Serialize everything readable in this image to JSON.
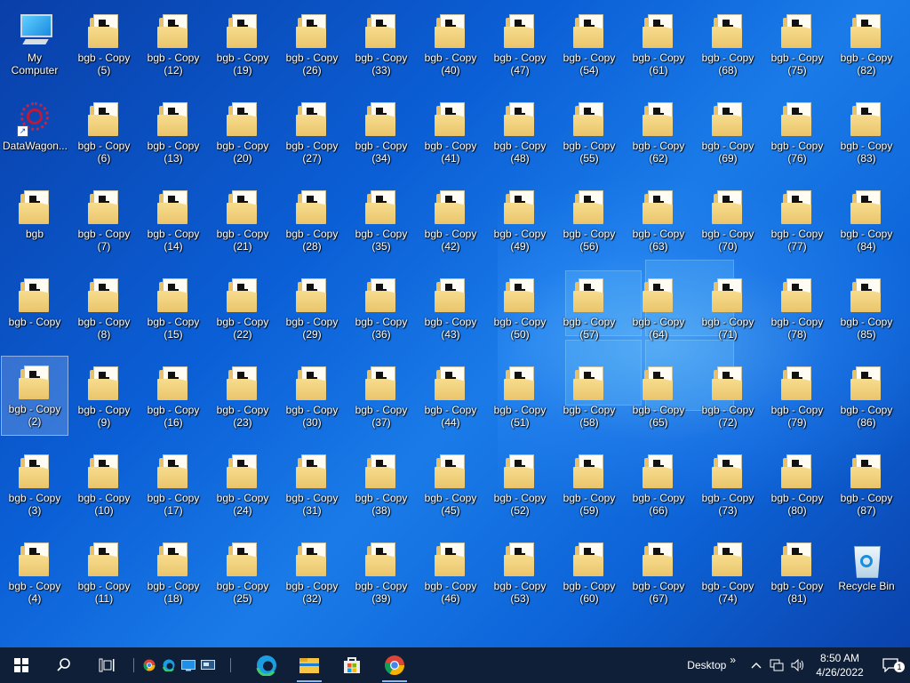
{
  "desktop": {
    "icons": [
      {
        "name": "pc-icon",
        "label": "My Computer",
        "col": 0,
        "row": 0,
        "type": "pc"
      },
      {
        "name": "datawagon-icon",
        "label": "DataWagon...",
        "col": 0,
        "row": 1,
        "type": "dw"
      },
      {
        "name": "folder-icon",
        "label": "bgb",
        "col": 0,
        "row": 2,
        "type": "folder"
      },
      {
        "name": "folder-icon",
        "label": "bgb - Copy",
        "col": 0,
        "row": 3,
        "type": "folder"
      },
      {
        "name": "folder-icon",
        "label": "bgb - Copy\n(2)",
        "col": 0,
        "row": 4,
        "type": "folder",
        "selected": true
      },
      {
        "name": "folder-icon",
        "label": "bgb - Copy\n(3)",
        "col": 0,
        "row": 5,
        "type": "folder"
      },
      {
        "name": "folder-icon",
        "label": "bgb - Copy\n(4)",
        "col": 0,
        "row": 6,
        "type": "folder"
      },
      {
        "name": "folder-icon",
        "label": "bgb - Copy\n(5)",
        "col": 1,
        "row": 0,
        "type": "folder"
      },
      {
        "name": "folder-icon",
        "label": "bgb - Copy\n(6)",
        "col": 1,
        "row": 1,
        "type": "folder"
      },
      {
        "name": "folder-icon",
        "label": "bgb - Copy\n(7)",
        "col": 1,
        "row": 2,
        "type": "folder"
      },
      {
        "name": "folder-icon",
        "label": "bgb - Copy\n(8)",
        "col": 1,
        "row": 3,
        "type": "folder"
      },
      {
        "name": "folder-icon",
        "label": "bgb - Copy\n(9)",
        "col": 1,
        "row": 4,
        "type": "folder"
      },
      {
        "name": "folder-icon",
        "label": "bgb - Copy\n(10)",
        "col": 1,
        "row": 5,
        "type": "folder"
      },
      {
        "name": "folder-icon",
        "label": "bgb - Copy\n(11)",
        "col": 1,
        "row": 6,
        "type": "folder"
      },
      {
        "name": "folder-icon",
        "label": "bgb - Copy\n(12)",
        "col": 2,
        "row": 0,
        "type": "folder"
      },
      {
        "name": "folder-icon",
        "label": "bgb - Copy\n(13)",
        "col": 2,
        "row": 1,
        "type": "folder"
      },
      {
        "name": "folder-icon",
        "label": "bgb - Copy\n(14)",
        "col": 2,
        "row": 2,
        "type": "folder"
      },
      {
        "name": "folder-icon",
        "label": "bgb - Copy\n(15)",
        "col": 2,
        "row": 3,
        "type": "folder"
      },
      {
        "name": "folder-icon",
        "label": "bgb - Copy\n(16)",
        "col": 2,
        "row": 4,
        "type": "folder"
      },
      {
        "name": "folder-icon",
        "label": "bgb - Copy\n(17)",
        "col": 2,
        "row": 5,
        "type": "folder"
      },
      {
        "name": "folder-icon",
        "label": "bgb - Copy\n(18)",
        "col": 2,
        "row": 6,
        "type": "folder"
      },
      {
        "name": "folder-icon",
        "label": "bgb - Copy\n(19)",
        "col": 3,
        "row": 0,
        "type": "folder"
      },
      {
        "name": "folder-icon",
        "label": "bgb - Copy\n(20)",
        "col": 3,
        "row": 1,
        "type": "folder"
      },
      {
        "name": "folder-icon",
        "label": "bgb - Copy\n(21)",
        "col": 3,
        "row": 2,
        "type": "folder"
      },
      {
        "name": "folder-icon",
        "label": "bgb - Copy\n(22)",
        "col": 3,
        "row": 3,
        "type": "folder"
      },
      {
        "name": "folder-icon",
        "label": "bgb - Copy\n(23)",
        "col": 3,
        "row": 4,
        "type": "folder"
      },
      {
        "name": "folder-icon",
        "label": "bgb - Copy\n(24)",
        "col": 3,
        "row": 5,
        "type": "folder"
      },
      {
        "name": "folder-icon",
        "label": "bgb - Copy\n(25)",
        "col": 3,
        "row": 6,
        "type": "folder"
      },
      {
        "name": "folder-icon",
        "label": "bgb - Copy\n(26)",
        "col": 4,
        "row": 0,
        "type": "folder"
      },
      {
        "name": "folder-icon",
        "label": "bgb - Copy\n(27)",
        "col": 4,
        "row": 1,
        "type": "folder"
      },
      {
        "name": "folder-icon",
        "label": "bgb - Copy\n(28)",
        "col": 4,
        "row": 2,
        "type": "folder"
      },
      {
        "name": "folder-icon",
        "label": "bgb - Copy\n(29)",
        "col": 4,
        "row": 3,
        "type": "folder"
      },
      {
        "name": "folder-icon",
        "label": "bgb - Copy\n(30)",
        "col": 4,
        "row": 4,
        "type": "folder"
      },
      {
        "name": "folder-icon",
        "label": "bgb - Copy\n(31)",
        "col": 4,
        "row": 5,
        "type": "folder"
      },
      {
        "name": "folder-icon",
        "label": "bgb - Copy\n(32)",
        "col": 4,
        "row": 6,
        "type": "folder"
      },
      {
        "name": "folder-icon",
        "label": "bgb - Copy\n(33)",
        "col": 5,
        "row": 0,
        "type": "folder"
      },
      {
        "name": "folder-icon",
        "label": "bgb - Copy\n(34)",
        "col": 5,
        "row": 1,
        "type": "folder"
      },
      {
        "name": "folder-icon",
        "label": "bgb - Copy\n(35)",
        "col": 5,
        "row": 2,
        "type": "folder"
      },
      {
        "name": "folder-icon",
        "label": "bgb - Copy\n(36)",
        "col": 5,
        "row": 3,
        "type": "folder"
      },
      {
        "name": "folder-icon",
        "label": "bgb - Copy\n(37)",
        "col": 5,
        "row": 4,
        "type": "folder"
      },
      {
        "name": "folder-icon",
        "label": "bgb - Copy\n(38)",
        "col": 5,
        "row": 5,
        "type": "folder"
      },
      {
        "name": "folder-icon",
        "label": "bgb - Copy\n(39)",
        "col": 5,
        "row": 6,
        "type": "folder"
      },
      {
        "name": "folder-icon",
        "label": "bgb - Copy\n(40)",
        "col": 6,
        "row": 0,
        "type": "folder"
      },
      {
        "name": "folder-icon",
        "label": "bgb - Copy\n(41)",
        "col": 6,
        "row": 1,
        "type": "folder"
      },
      {
        "name": "folder-icon",
        "label": "bgb - Copy\n(42)",
        "col": 6,
        "row": 2,
        "type": "folder"
      },
      {
        "name": "folder-icon",
        "label": "bgb - Copy\n(43)",
        "col": 6,
        "row": 3,
        "type": "folder"
      },
      {
        "name": "folder-icon",
        "label": "bgb - Copy\n(44)",
        "col": 6,
        "row": 4,
        "type": "folder"
      },
      {
        "name": "folder-icon",
        "label": "bgb - Copy\n(45)",
        "col": 6,
        "row": 5,
        "type": "folder"
      },
      {
        "name": "folder-icon",
        "label": "bgb - Copy\n(46)",
        "col": 6,
        "row": 6,
        "type": "folder"
      },
      {
        "name": "folder-icon",
        "label": "bgb - Copy\n(47)",
        "col": 7,
        "row": 0,
        "type": "folder"
      },
      {
        "name": "folder-icon",
        "label": "bgb - Copy\n(48)",
        "col": 7,
        "row": 1,
        "type": "folder"
      },
      {
        "name": "folder-icon",
        "label": "bgb - Copy\n(49)",
        "col": 7,
        "row": 2,
        "type": "folder"
      },
      {
        "name": "folder-icon",
        "label": "bgb - Copy\n(50)",
        "col": 7,
        "row": 3,
        "type": "folder"
      },
      {
        "name": "folder-icon",
        "label": "bgb - Copy\n(51)",
        "col": 7,
        "row": 4,
        "type": "folder"
      },
      {
        "name": "folder-icon",
        "label": "bgb - Copy\n(52)",
        "col": 7,
        "row": 5,
        "type": "folder"
      },
      {
        "name": "folder-icon",
        "label": "bgb - Copy\n(53)",
        "col": 7,
        "row": 6,
        "type": "folder"
      },
      {
        "name": "folder-icon",
        "label": "bgb - Copy\n(54)",
        "col": 8,
        "row": 0,
        "type": "folder"
      },
      {
        "name": "folder-icon",
        "label": "bgb - Copy\n(55)",
        "col": 8,
        "row": 1,
        "type": "folder"
      },
      {
        "name": "folder-icon",
        "label": "bgb - Copy\n(56)",
        "col": 8,
        "row": 2,
        "type": "folder"
      },
      {
        "name": "folder-icon",
        "label": "bgb - Copy\n(57)",
        "col": 8,
        "row": 3,
        "type": "folder"
      },
      {
        "name": "folder-icon",
        "label": "bgb - Copy\n(58)",
        "col": 8,
        "row": 4,
        "type": "folder"
      },
      {
        "name": "folder-icon",
        "label": "bgb - Copy\n(59)",
        "col": 8,
        "row": 5,
        "type": "folder"
      },
      {
        "name": "folder-icon",
        "label": "bgb - Copy\n(60)",
        "col": 8,
        "row": 6,
        "type": "folder"
      },
      {
        "name": "folder-icon",
        "label": "bgb - Copy\n(61)",
        "col": 9,
        "row": 0,
        "type": "folder"
      },
      {
        "name": "folder-icon",
        "label": "bgb - Copy\n(62)",
        "col": 9,
        "row": 1,
        "type": "folder"
      },
      {
        "name": "folder-icon",
        "label": "bgb - Copy\n(63)",
        "col": 9,
        "row": 2,
        "type": "folder"
      },
      {
        "name": "folder-icon",
        "label": "bgb - Copy\n(64)",
        "col": 9,
        "row": 3,
        "type": "folder"
      },
      {
        "name": "folder-icon",
        "label": "bgb - Copy\n(65)",
        "col": 9,
        "row": 4,
        "type": "folder"
      },
      {
        "name": "folder-icon",
        "label": "bgb - Copy\n(66)",
        "col": 9,
        "row": 5,
        "type": "folder"
      },
      {
        "name": "folder-icon",
        "label": "bgb - Copy\n(67)",
        "col": 9,
        "row": 6,
        "type": "folder"
      },
      {
        "name": "folder-icon",
        "label": "bgb - Copy\n(68)",
        "col": 10,
        "row": 0,
        "type": "folder"
      },
      {
        "name": "folder-icon",
        "label": "bgb - Copy\n(69)",
        "col": 10,
        "row": 1,
        "type": "folder"
      },
      {
        "name": "folder-icon",
        "label": "bgb - Copy\n(70)",
        "col": 10,
        "row": 2,
        "type": "folder"
      },
      {
        "name": "folder-icon",
        "label": "bgb - Copy\n(71)",
        "col": 10,
        "row": 3,
        "type": "folder"
      },
      {
        "name": "folder-icon",
        "label": "bgb - Copy\n(72)",
        "col": 10,
        "row": 4,
        "type": "folder"
      },
      {
        "name": "folder-icon",
        "label": "bgb - Copy\n(73)",
        "col": 10,
        "row": 5,
        "type": "folder"
      },
      {
        "name": "folder-icon",
        "label": "bgb - Copy\n(74)",
        "col": 10,
        "row": 6,
        "type": "folder"
      },
      {
        "name": "folder-icon",
        "label": "bgb - Copy\n(75)",
        "col": 11,
        "row": 0,
        "type": "folder"
      },
      {
        "name": "folder-icon",
        "label": "bgb - Copy\n(76)",
        "col": 11,
        "row": 1,
        "type": "folder"
      },
      {
        "name": "folder-icon",
        "label": "bgb - Copy\n(77)",
        "col": 11,
        "row": 2,
        "type": "folder"
      },
      {
        "name": "folder-icon",
        "label": "bgb - Copy\n(78)",
        "col": 11,
        "row": 3,
        "type": "folder"
      },
      {
        "name": "folder-icon",
        "label": "bgb - Copy\n(79)",
        "col": 11,
        "row": 4,
        "type": "folder"
      },
      {
        "name": "folder-icon",
        "label": "bgb - Copy\n(80)",
        "col": 11,
        "row": 5,
        "type": "folder"
      },
      {
        "name": "folder-icon",
        "label": "bgb - Copy\n(81)",
        "col": 11,
        "row": 6,
        "type": "folder"
      },
      {
        "name": "folder-icon",
        "label": "bgb - Copy\n(82)",
        "col": 12,
        "row": 0,
        "type": "folder"
      },
      {
        "name": "folder-icon",
        "label": "bgb - Copy\n(83)",
        "col": 12,
        "row": 1,
        "type": "folder"
      },
      {
        "name": "folder-icon",
        "label": "bgb - Copy\n(84)",
        "col": 12,
        "row": 2,
        "type": "folder"
      },
      {
        "name": "folder-icon",
        "label": "bgb - Copy\n(85)",
        "col": 12,
        "row": 3,
        "type": "folder"
      },
      {
        "name": "folder-icon",
        "label": "bgb - Copy\n(86)",
        "col": 12,
        "row": 4,
        "type": "folder"
      },
      {
        "name": "folder-icon",
        "label": "bgb - Copy\n(87)",
        "col": 12,
        "row": 5,
        "type": "folder"
      },
      {
        "name": "recycle-bin-icon",
        "label": "Recycle Bin",
        "col": 12,
        "row": 6,
        "type": "bin"
      }
    ]
  },
  "taskbar": {
    "desktop_label": "Desktop",
    "overflow_glyph": "»",
    "time": "8:50 AM",
    "date": "4/26/2022",
    "notification_count": "1",
    "icons": {
      "start": "windows-start-icon",
      "search": "search-icon",
      "task_view": "task-view-icon",
      "quick_chrome": "chrome-icon",
      "quick_edge": "edge-icon",
      "quick_desktop": "show-desktop-icon",
      "quick_remote": "remote-desktop-icon",
      "edge": "edge-icon",
      "explorer": "file-explorer-icon",
      "store": "microsoft-store-icon",
      "chrome": "chrome-icon",
      "chevron": "chevron-up-icon",
      "network": "network-icon",
      "volume": "speaker-icon",
      "notifications": "notification-icon"
    }
  },
  "colors": {
    "taskbar_bg": "#0f1f37",
    "desktop_blue": "#0b5fd6",
    "folder_yellow": "#f7dd8e"
  }
}
